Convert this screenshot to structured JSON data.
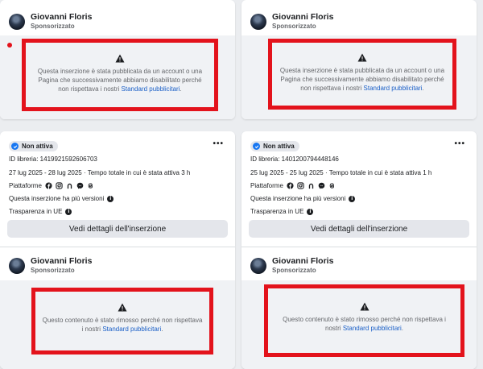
{
  "cards_top": [
    {
      "advertiser_name": "Giovanni Floris",
      "advertiser_sub": "Sponsorizzato",
      "warning_text": "Questa inserzione è stata pubblicata da un account o una Pagina che successivamente abbiamo disabilitato perché non rispettava i nostri",
      "warning_link": "Standard pubblicitari",
      "warning_end": "."
    },
    {
      "advertiser_name": "Giovanni Floris",
      "advertiser_sub": "Sponsorizzato",
      "warning_text": "Questa inserzione è stata pubblicata da un account o una Pagina che successivamente abbiamo disabilitato perché non rispettava i nostri",
      "warning_link": "Standard pubblicitari",
      "warning_end": "."
    }
  ],
  "cards_bottom": [
    {
      "status": "Non attiva",
      "more": "•••",
      "library_id": "ID libreria: 1419921592606703",
      "dates": "27 lug 2025 - 28 lug 2025 · Tempo totale in cui è stata attiva 3 h",
      "platforms_label": "Piattaforme",
      "versions_label": "Questa inserzione ha più versioni",
      "transparency_label": "Trasparenza in UE",
      "details_button": "Vedi dettagli dell'inserzione",
      "advertiser_name": "Giovanni Floris",
      "advertiser_sub": "Sponsorizzato",
      "removed_text": "Questo contenuto è stato rimosso perché non rispettava i nostri",
      "removed_link": "Standard pubblicitari",
      "removed_end": "."
    },
    {
      "status": "Non attiva",
      "more": "•••",
      "library_id": "ID libreria: 1401200794448146",
      "dates": "25 lug 2025 - 25 lug 2025 · Tempo totale in cui è stata attiva 1 h",
      "platforms_label": "Piattaforme",
      "versions_label": "Questa inserzione ha più versioni",
      "transparency_label": "Trasparenza in UE",
      "details_button": "Vedi dettagli dell'inserzione",
      "advertiser_name": "Giovanni Floris",
      "advertiser_sub": "Sponsorizzato",
      "removed_text": "Questo contenuto è stato rimosso perché non rispettava i nostri",
      "removed_link": "Standard pubblicitari",
      "removed_end": "."
    }
  ],
  "colors": {
    "highlight_red": "#e3131c",
    "link_blue": "#1a5fc7",
    "status_blue": "#1877f2"
  },
  "icons": {
    "platforms": [
      "facebook-icon",
      "instagram-icon",
      "audience-network-icon",
      "messenger-icon",
      "threads-icon"
    ],
    "warning": "warning-triangle-icon",
    "info": "info-icon"
  }
}
